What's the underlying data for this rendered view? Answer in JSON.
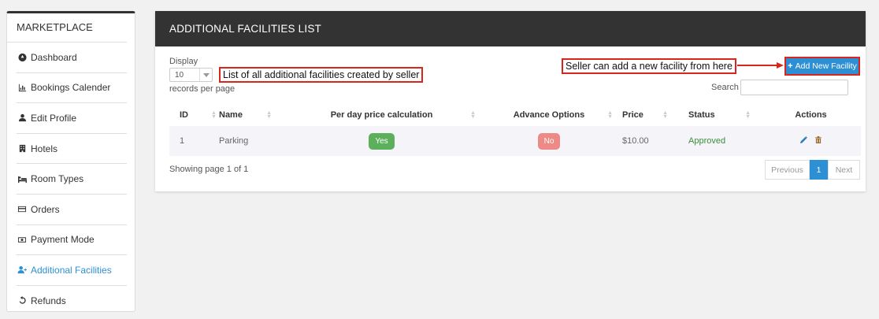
{
  "sidebar": {
    "title": "MARKETPLACE",
    "items": [
      {
        "label": "Dashboard",
        "icon": "dashboard-icon"
      },
      {
        "label": "Bookings Calender",
        "icon": "chart-icon"
      },
      {
        "label": "Edit Profile",
        "icon": "user-icon"
      },
      {
        "label": "Hotels",
        "icon": "building-icon"
      },
      {
        "label": "Room Types",
        "icon": "bed-icon"
      },
      {
        "label": "Orders",
        "icon": "credit-card-icon"
      },
      {
        "label": "Payment Mode",
        "icon": "money-icon"
      },
      {
        "label": "Additional Facilities",
        "icon": "user-plus-icon"
      },
      {
        "label": "Refunds",
        "icon": "undo-icon"
      }
    ]
  },
  "panel": {
    "title": "ADDITIONAL FACILITIES LIST",
    "display_label": "Display",
    "page_size": "10",
    "records_per_page": "records per page",
    "search_label": "Search",
    "add_button": "Add New Facility",
    "annotation_list": "List of all additional facilities created by seller",
    "annotation_add": "Seller can add a new facility from here",
    "accent_color": "#2d90d5",
    "annotation_color": "#d9261c"
  },
  "table": {
    "headers": [
      "ID",
      "Name",
      "Per day price calculation",
      "Advance Options",
      "Price",
      "Status",
      "Actions"
    ],
    "rows": [
      {
        "id": "1",
        "name": "Parking",
        "per_day": "Yes",
        "advance": "No",
        "price": "$10.00",
        "status": "Approved"
      }
    ]
  },
  "footer": {
    "showing": "Showing page 1 of 1",
    "previous": "Previous",
    "current_page": "1",
    "next": "Next"
  }
}
